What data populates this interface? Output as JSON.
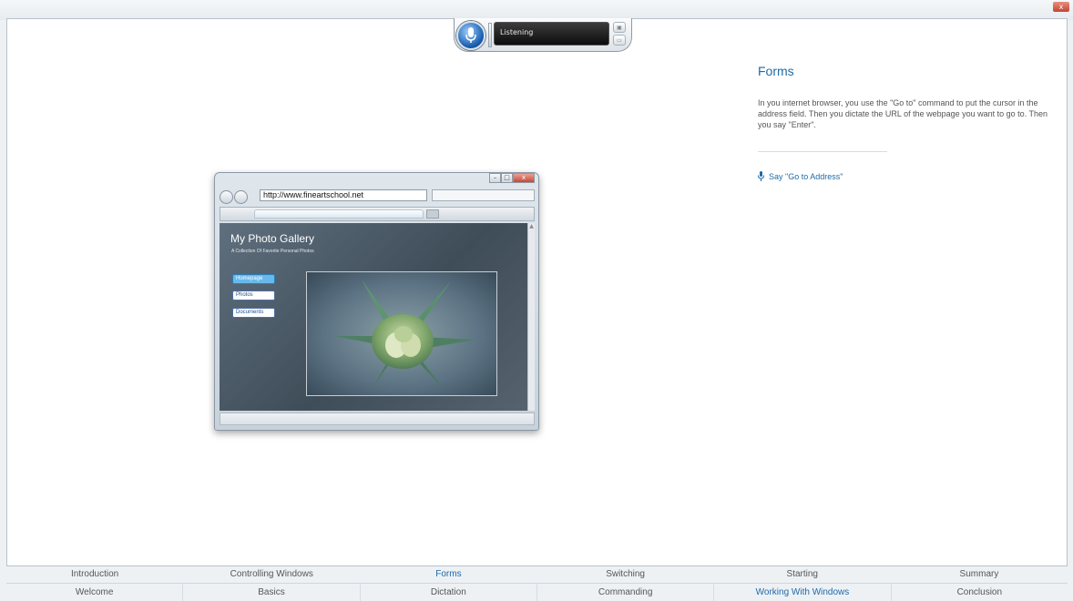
{
  "window": {
    "close_label": "x"
  },
  "speech": {
    "status": "Listening"
  },
  "panel": {
    "title": "Forms",
    "body": "In you internet browser, you use the \"Go to\" command to put the cursor in the address field. Then you dictate the URL of the webpage you want to go to. Then you say \"Enter\".",
    "prompt": "Say \"Go to Address\""
  },
  "demo_browser": {
    "url": "http://www.fineartschool.net",
    "page": {
      "title": "My Photo Gallery",
      "subtitle": "A Collection Of Favorite Personal Photos",
      "nav": [
        "Homepage",
        "Photos",
        "Documents"
      ]
    }
  },
  "nav_top": [
    "Introduction",
    "Controlling Windows",
    "Forms",
    "Switching",
    "Starting",
    "Summary"
  ],
  "nav_bottom": [
    "Welcome",
    "Basics",
    "Dictation",
    "Commanding",
    "Working With Windows",
    "Conclusion"
  ],
  "colors": {
    "accent": "#1f6aa8",
    "active_button": "#67b9ec"
  }
}
